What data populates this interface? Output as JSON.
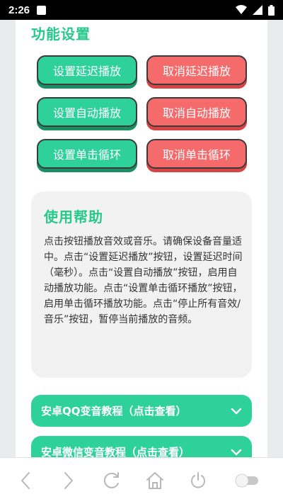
{
  "status_bar": {
    "time": "2:26"
  },
  "feature_settings": {
    "title": "功能设置",
    "buttons": [
      {
        "label": "设置延迟播放",
        "color": "#2fd19a"
      },
      {
        "label": "取消延迟播放",
        "color": "#f56b6b"
      },
      {
        "label": "设置自动播放",
        "color": "#2fd19a"
      },
      {
        "label": "取消自动播放",
        "color": "#f56b6b"
      },
      {
        "label": "设置单击循环",
        "color": "#2fd19a"
      },
      {
        "label": "取消单击循环",
        "color": "#f56b6b"
      }
    ]
  },
  "help": {
    "title": "使用帮助",
    "text": "点击按钮播放音效或音乐。请确保设备音量适中。点击“设置延迟播放”按钮，设置延迟时间（毫秒）。点击“设置自动播放”按钮，启用自动播放功能。点击“设置单击循环播放”按钮，启用单击循环播放功能。点击“停止所有音效/音乐”按钮，暂停当前播放的音频。"
  },
  "accordions": [
    {
      "label": "安卓QQ变音教程（点击查看）"
    },
    {
      "label": "安卓微信变音教程（点击查看）"
    }
  ],
  "toolbar": {
    "icons": [
      "back-icon",
      "forward-icon",
      "refresh-icon",
      "home-icon",
      "power-icon",
      "toggle-icon"
    ]
  },
  "colors": {
    "accent_green": "#2fd19a",
    "accent_red": "#f56b6b",
    "title_green": "#26c98b"
  }
}
